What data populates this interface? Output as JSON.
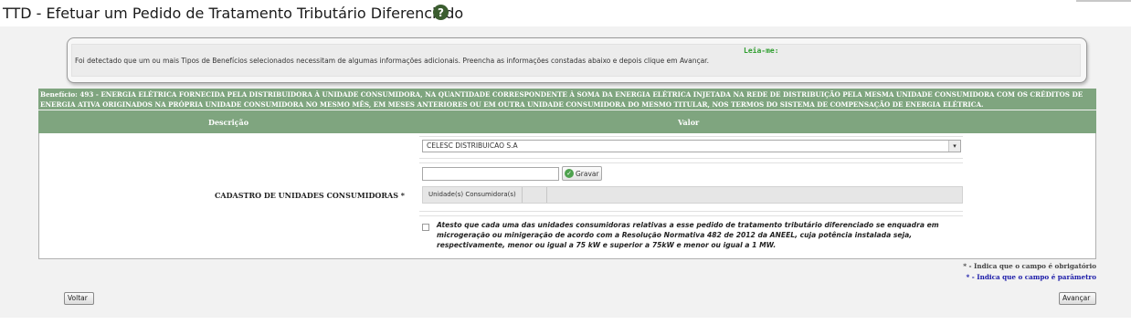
{
  "page": {
    "title": "TTD - Efetuar um Pedido de Tratamento Tributário Diferenciado",
    "help_icon_label": "?"
  },
  "readme": {
    "title": "Leia-me:",
    "text": "Foi detectado que um ou mais Tipos de Benefícios selecionados necessitam de algumas informações adicionais. Preencha as informações constadas abaixo e depois clique em Avançar."
  },
  "benefit": {
    "header": "Benefício: 493 - ENERGIA ELÉTRICA FORNECIDA PELA DISTRIBUIDORA À UNIDADE CONSUMIDORA, NA QUANTIDADE CORRESPONDENTE À SOMA DA ENERGIA ELÉTRICA INJETADA NA REDE DE DISTRIBUIÇÃO PELA MESMA UNIDADE CONSUMIDORA COM OS CRÉDITOS DE ENERGIA ATIVA ORIGINADOS NA PRÓPRIA UNIDADE CONSUMIDORA NO MESMO MÊS, EM MESES ANTERIORES OU EM OUTRA UNIDADE CONSUMIDORA DO MESMO TITULAR, NOS TERMOS DO SISTEMA DE COMPENSAÇÃO DE ENERGIA ELÉTRICA."
  },
  "table": {
    "col_description": "Descrição",
    "col_value": "Valor"
  },
  "form": {
    "field_label": "CADASTRO DE UNIDADES CONSUMIDORAS *",
    "distributor_selected": "CELESC DISTRIBUICAO S.A",
    "unit_input_value": "",
    "save_label": "Gravar",
    "units_column_header": "Unidade(s) Consumidora(s)",
    "attest_text": "Atesto que cada uma das unidades consumidoras relativas a esse pedido de tratamento tributário diferenciado se enquadra em microgeração ou minigeração de acordo com a Resolução Normativa 482 de 2012 da ANEEL, cuja potência instalada seja, respectivamente, menor ou igual a 75 kW e superior a 75kW e menor ou igual a 1 MW.",
    "attest_checked": false
  },
  "notes": {
    "required": "* - Indica que o campo é obrigatório",
    "parameter": "* - Indica que o campo é parâmetro"
  },
  "buttons": {
    "back": "Voltar",
    "next": "Avançar"
  },
  "colors": {
    "header_green": "#7fa57f",
    "readme_title": "#2f9e2f",
    "parameter_note": "#1a1aa8",
    "help_icon": "#3b5d2f"
  }
}
